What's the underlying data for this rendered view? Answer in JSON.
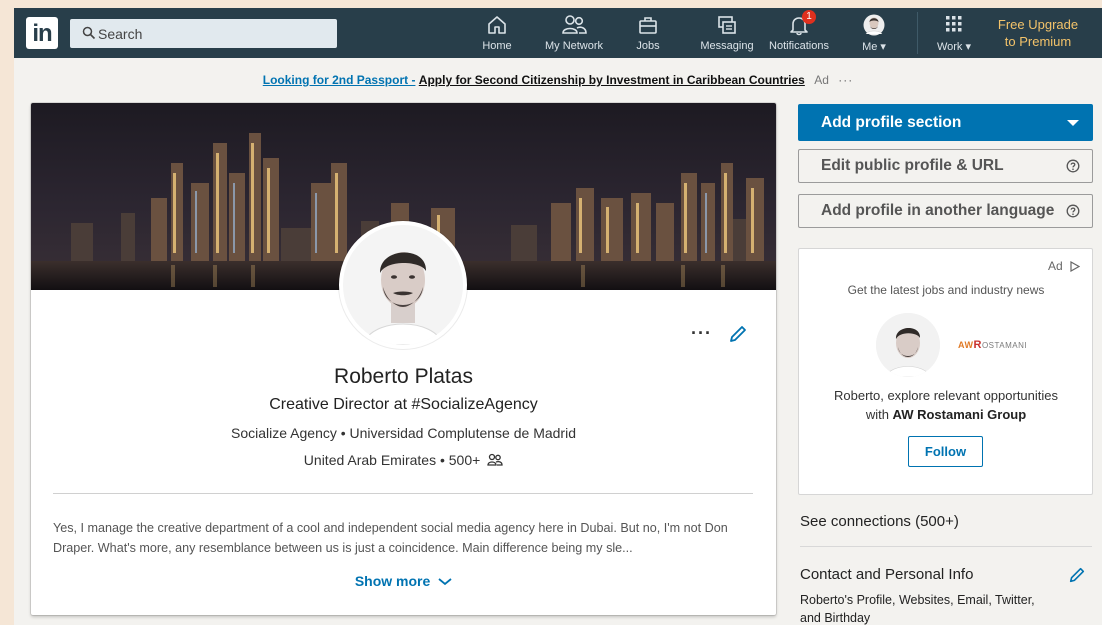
{
  "nav": {
    "logo": "in",
    "search_placeholder": "Search",
    "items": [
      {
        "label": "Home",
        "icon": "home-icon"
      },
      {
        "label": "My Network",
        "icon": "my-network-icon"
      },
      {
        "label": "Jobs",
        "icon": "jobs-icon"
      },
      {
        "label": "Messaging",
        "icon": "messaging-icon"
      },
      {
        "label": "Notifications",
        "icon": "notifications-icon",
        "badge": "1"
      },
      {
        "label": "Me",
        "icon": "me-avatar"
      },
      {
        "label": "Work",
        "icon": "work-grid-icon"
      }
    ],
    "premium_line1": "Free Upgrade",
    "premium_line2": "to Premium"
  },
  "ad_line": {
    "link": "Looking for 2nd Passport -",
    "text": "Apply for Second Citizenship by Investment in Caribbean Countries",
    "tag": "Ad",
    "more": "···"
  },
  "profile": {
    "name": "Roberto Platas",
    "headline": "Creative Director at #SocializeAgency",
    "meta": "Socialize Agency • Universidad Complutense de Madrid",
    "location": "United Arab Emirates • 500+",
    "summary": "Yes, I manage the creative department of a cool and independent social media agency here in Dubai. But no, I'm not Don Draper. What's more, any resemblance between us is just a coincidence. Main difference being my sle...",
    "show_more": "Show more",
    "more_dots": "···"
  },
  "rail": {
    "add_section": "Add profile section",
    "edit_public": "Edit public profile & URL",
    "add_language": "Add profile in another language",
    "ad": {
      "label": "Ad",
      "headline": "Get the latest jobs and industry news",
      "body_line1": "Roberto, explore relevant opportunities",
      "body_prefix": "with ",
      "company": "AW Rostamani Group",
      "logo_aw": "AW",
      "logo_r": "R",
      "logo_rest": "OSTAMANI",
      "follow": "Follow"
    },
    "see_connections": "See connections (500+)",
    "contact_title": "Contact and Personal Info",
    "contact_sub": "Roberto's Profile, Websites, Email, Twitter, and Birthday"
  },
  "colors": {
    "nav_bg": "#283e4a",
    "accent": "#0073b1",
    "premium": "#f3c36a",
    "badge": "#e0301e"
  }
}
